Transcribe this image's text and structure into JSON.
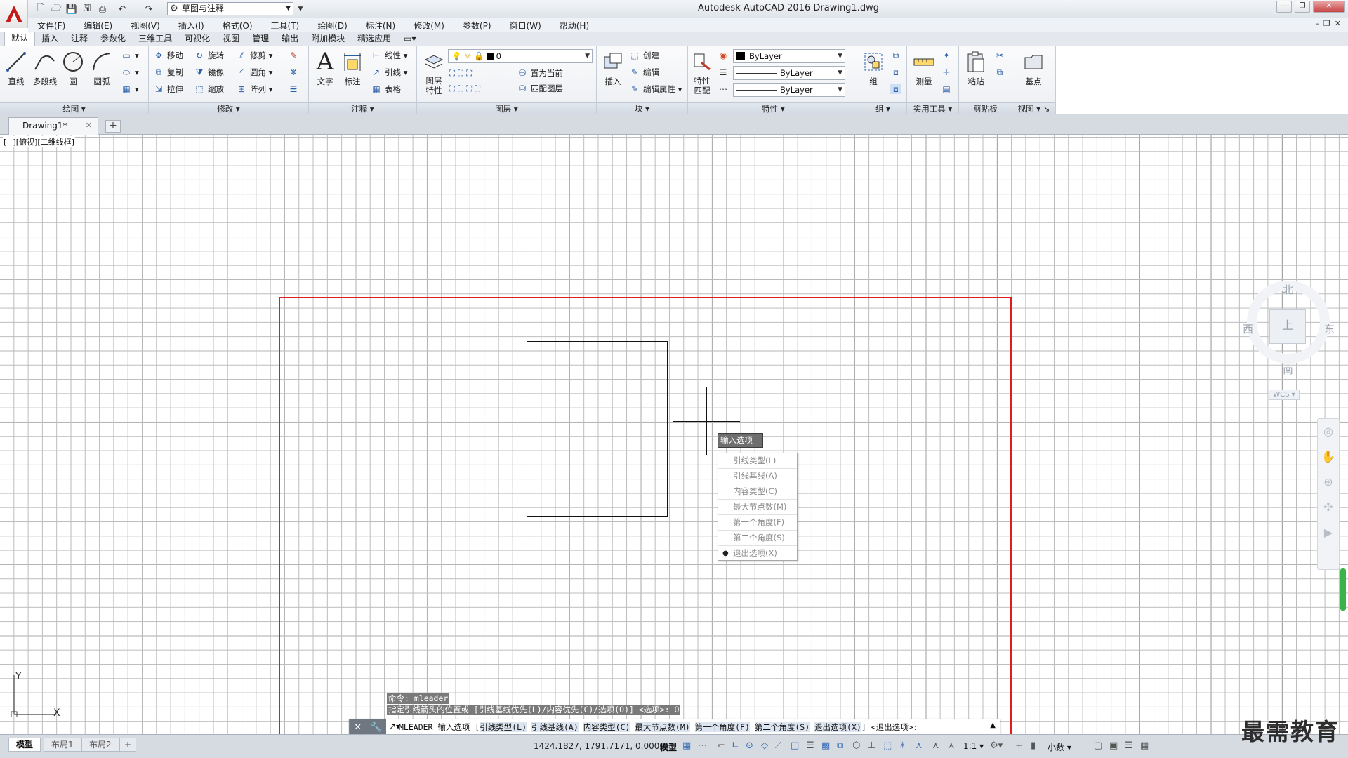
{
  "window": {
    "title": "Autodesk AutoCAD 2016    Drawing1.dwg",
    "workspace": "草图与注释",
    "controls": [
      "—",
      "❐",
      "✕"
    ]
  },
  "menubar": [
    "文件(F)",
    "编辑(E)",
    "视图(V)",
    "插入(I)",
    "格式(O)",
    "工具(T)",
    "绘图(D)",
    "标注(N)",
    "修改(M)",
    "参数(P)",
    "窗口(W)",
    "帮助(H)"
  ],
  "ribbon_tabs": [
    "默认",
    "插入",
    "注释",
    "参数化",
    "三维工具",
    "可视化",
    "视图",
    "管理",
    "输出",
    "附加模块",
    "精选应用"
  ],
  "panels": {
    "draw": {
      "title": "绘图",
      "line": "直线",
      "polyline": "多段线",
      "circle": "圆",
      "arc": "圆弧"
    },
    "modify": {
      "title": "修改",
      "move": "移动",
      "rotate": "旋转",
      "trim": "修剪",
      "copy": "复制",
      "mirror": "镜像",
      "fillet": "圆角",
      "stretch": "拉伸",
      "scale": "缩放",
      "array": "阵列"
    },
    "annotation": {
      "title": "注释",
      "text": "文字",
      "dimension": "标注",
      "linear": "线性",
      "leader": "引线",
      "table": "表格"
    },
    "layers": {
      "title": "图层",
      "properties": "图层特性",
      "current_layer": "0",
      "set_current": "置为当前",
      "match_layer": "匹配图层"
    },
    "block": {
      "title": "块",
      "insert": "插入",
      "create": "创建",
      "edit": "编辑",
      "edit_attr": "编辑属性"
    },
    "properties": {
      "title": "特性",
      "match": "特性匹配",
      "color": "ByLayer",
      "linetype": "ByLayer",
      "lineweight": "ByLayer"
    },
    "groups": {
      "title": "组",
      "group": "组"
    },
    "utilities": {
      "title": "实用工具",
      "measure": "测量"
    },
    "clipboard": {
      "title": "剪贴板",
      "paste": "粘贴"
    },
    "view": {
      "title": "视图",
      "base": "基点"
    }
  },
  "document_tab": "Drawing1*",
  "viewport_label": "[−][俯视][二维线框]",
  "viewcube": {
    "north": "北",
    "south": "南",
    "east": "东",
    "west": "西",
    "face": "上",
    "wcs": "WCS ▾"
  },
  "tooltip": "输入选项",
  "options_menu": [
    "引线类型(L)",
    "引线基线(A)",
    "内容类型(C)",
    "最大节点数(M)",
    "第一个角度(F)",
    "第二个角度(S)",
    "退出选项(X)"
  ],
  "options_selected": "退出选项(X)",
  "command_history": [
    "命令:  mleader",
    "指定引线箭头的位置或 [引线基线优先(L)/内容优先(C)/选项(O)] <选项>: O"
  ],
  "command_line": {
    "prefix": "MLEADER 输入选项 [",
    "options": [
      "引线类型(L)",
      "引线基线(A)",
      "内容类型(C)",
      "最大节点数(M)",
      "第一个角度(F)",
      "第二个角度(S)",
      "退出选项(X)"
    ],
    "suffix": "] <退出选项>:"
  },
  "ucs": {
    "x": "X",
    "y": "Y"
  },
  "layout_tabs": [
    "模型",
    "布局1",
    "布局2"
  ],
  "status": {
    "coords": "1424.1827, 1791.7171, 0.0000",
    "model": "模型",
    "scale": "1:1",
    "units": "小数"
  },
  "watermark": "最需教育",
  "colors": {
    "accent_red": "#e01c1c",
    "tooltip_bg": "#6e6e6e",
    "ribbon_title": "#d3dae3"
  }
}
